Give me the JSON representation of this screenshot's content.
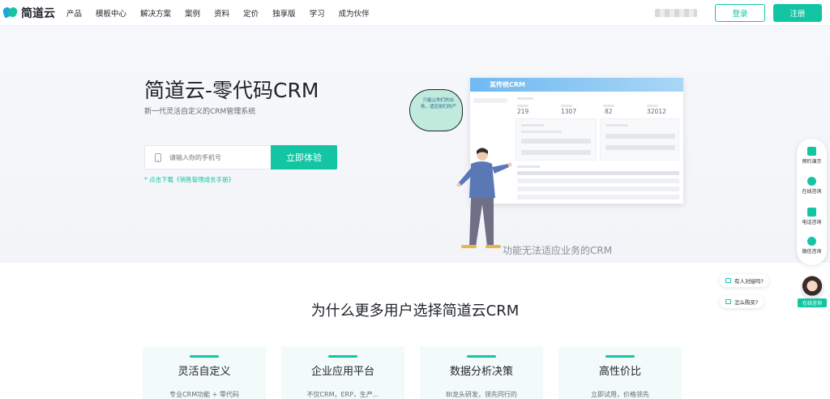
{
  "brand": {
    "logo_text": "简道云",
    "accent": "#14c5a3"
  },
  "nav": {
    "items": [
      "产品",
      "模板中心",
      "解决方案",
      "案例",
      "资料",
      "定价",
      "独享版",
      "学习",
      "成为伙伴"
    ]
  },
  "header": {
    "login_label": "登录",
    "register_label": "注册"
  },
  "hero": {
    "title": "简道云-零代码CRM",
    "subtitle": "新一代灵活自定义的CRM管理系统",
    "phone_placeholder": "请输入你的手机号",
    "try_label": "立即体验",
    "download_link": "* 点击下载《销售管理成长手册》",
    "caption": "功能无法适应业务的CRM",
    "bubble_text": "只能让你们的业务，适应别们的产",
    "mock": {
      "title": "某传统CRM",
      "numbers": [
        "219",
        "1307",
        "82",
        "32012"
      ]
    }
  },
  "side_float": {
    "items": [
      "预约演示",
      "在线咨询",
      "电话咨询",
      "微信咨询"
    ]
  },
  "chat": {
    "pills": [
      "有人对接吗?",
      "怎么购买?"
    ],
    "online_label": "在线咨询"
  },
  "why": {
    "title": "为什么更多用户选择简道云CRM",
    "cards": [
      {
        "title": "灵活自定义",
        "desc": "专业CRM功能 + 零代码"
      },
      {
        "title": "企业应用平台",
        "desc": "不仅CRM，ERP，生产..."
      },
      {
        "title": "数据分析决策",
        "desc": "BI龙头研发，领先同行的"
      },
      {
        "title": "高性价比",
        "desc": "立即试用，价格领先"
      }
    ]
  }
}
